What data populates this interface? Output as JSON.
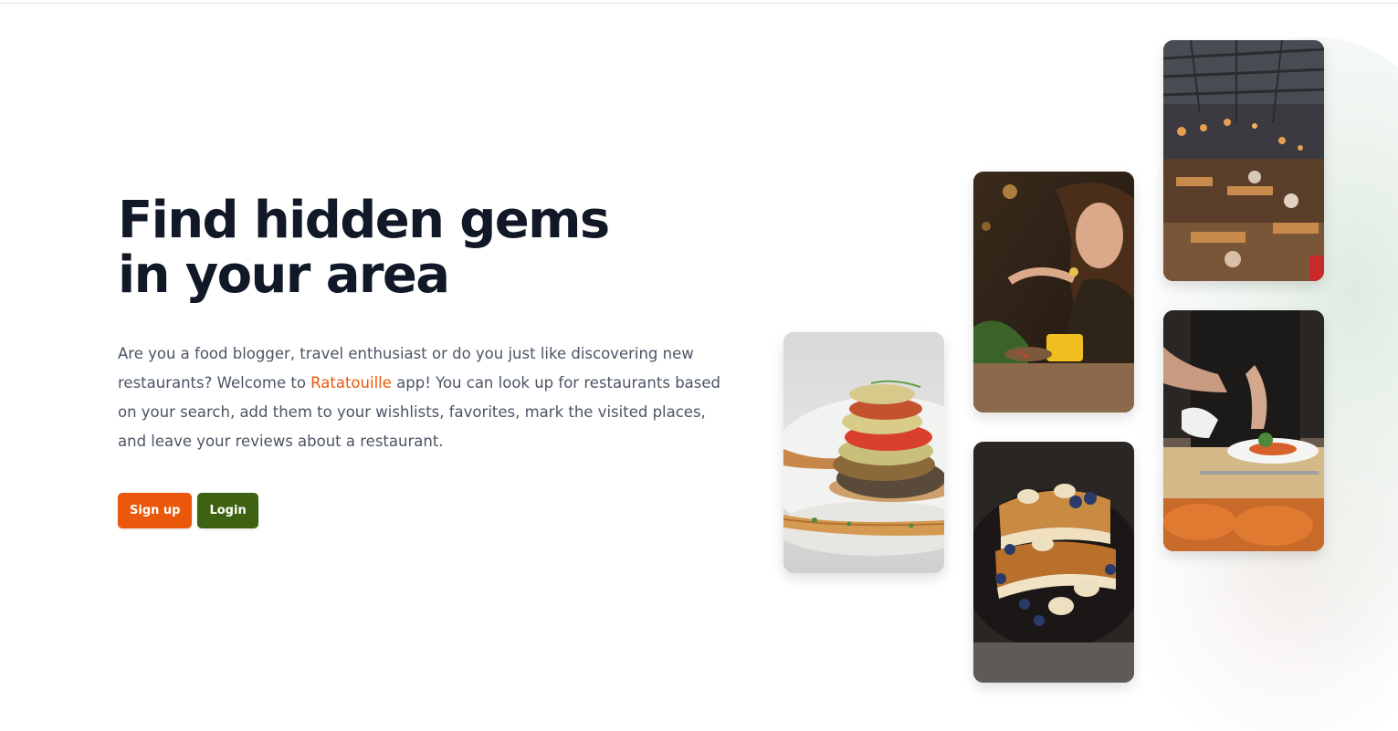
{
  "hero": {
    "headline": "Find hidden gems in your area",
    "intro_before": "Are you a food blogger, travel enthusiast or do you just like discovering new restaurants? Welcome to ",
    "brand": "Ratatouille",
    "intro_after": " app! You can look up for restaurants based on your search, add them to your wishlists, favorites, mark the visited places, and leave your reviews about a restaurant."
  },
  "actions": {
    "signup_label": "Sign up",
    "login_label": "Login"
  },
  "colors": {
    "brand_accent": "#ea580c",
    "login_button": "#3f6212",
    "headline": "#111827",
    "body_text": "#4b5563"
  },
  "gallery": {
    "images": [
      "ratatouille-dish-photo",
      "woman-dining-photo",
      "french-toast-photo",
      "restaurant-hall-photo",
      "chef-plating-photo"
    ]
  }
}
